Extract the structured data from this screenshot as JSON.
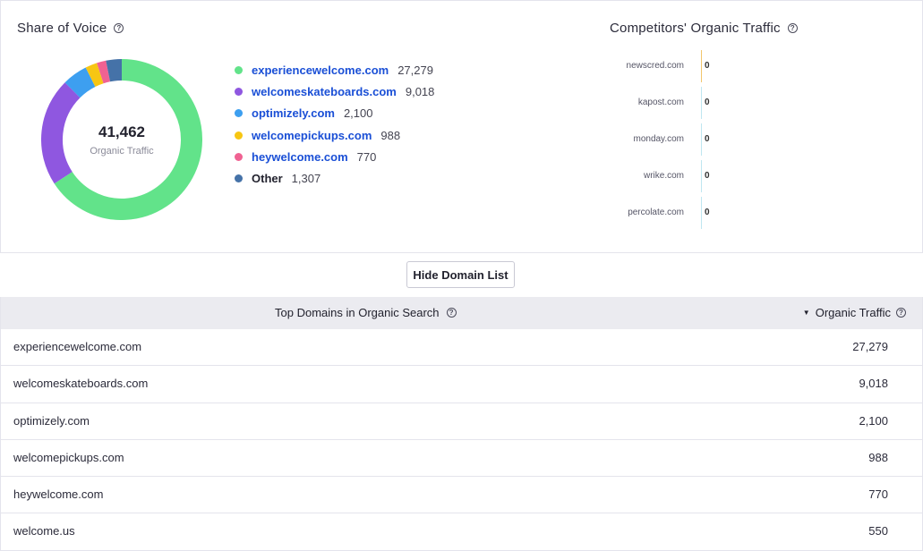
{
  "share_of_voice": {
    "title": "Share of Voice",
    "total": "41,462",
    "total_label": "Organic Traffic",
    "items": [
      {
        "domain": "experiencewelcome.com",
        "value": "27,279",
        "raw": 27279,
        "color": "#62e38a",
        "link": true
      },
      {
        "domain": "welcomeskateboards.com",
        "value": "9,018",
        "raw": 9018,
        "color": "#8f57e0",
        "link": true
      },
      {
        "domain": "optimizely.com",
        "value": "2,100",
        "raw": 2100,
        "color": "#3d9ff0",
        "link": true
      },
      {
        "domain": "welcomepickups.com",
        "value": "988",
        "raw": 988,
        "color": "#f7c613",
        "link": true
      },
      {
        "domain": "heywelcome.com",
        "value": "770",
        "raw": 770,
        "color": "#f06292",
        "link": true
      },
      {
        "domain": "Other",
        "value": "1,307",
        "raw": 1307,
        "color": "#4572a8",
        "link": false
      }
    ]
  },
  "competitors": {
    "title": "Competitors' Organic Traffic",
    "items": [
      {
        "domain": "newscred.com",
        "value": "0",
        "color": "#f2c66d"
      },
      {
        "domain": "kapost.com",
        "value": "0",
        "color": "#bfe6f0"
      },
      {
        "domain": "monday.com",
        "value": "0",
        "color": "#bfe6f0"
      },
      {
        "domain": "wrike.com",
        "value": "0",
        "color": "#bfe6f0"
      },
      {
        "domain": "percolate.com",
        "value": "0",
        "color": "#bfe6f0"
      }
    ]
  },
  "hide_button_label": "Hide Domain List",
  "table": {
    "col_domain": "Top Domains in Organic Search",
    "col_traffic": "Organic Traffic",
    "rows": [
      {
        "domain": "experiencewelcome.com",
        "traffic": "27,279"
      },
      {
        "domain": "welcomeskateboards.com",
        "traffic": "9,018"
      },
      {
        "domain": "optimizely.com",
        "traffic": "2,100"
      },
      {
        "domain": "welcomepickups.com",
        "traffic": "988"
      },
      {
        "domain": "heywelcome.com",
        "traffic": "770"
      },
      {
        "domain": "welcome.us",
        "traffic": "550"
      }
    ]
  },
  "icons": {
    "help": "question-circle-icon",
    "sort": "caret-down-icon"
  }
}
